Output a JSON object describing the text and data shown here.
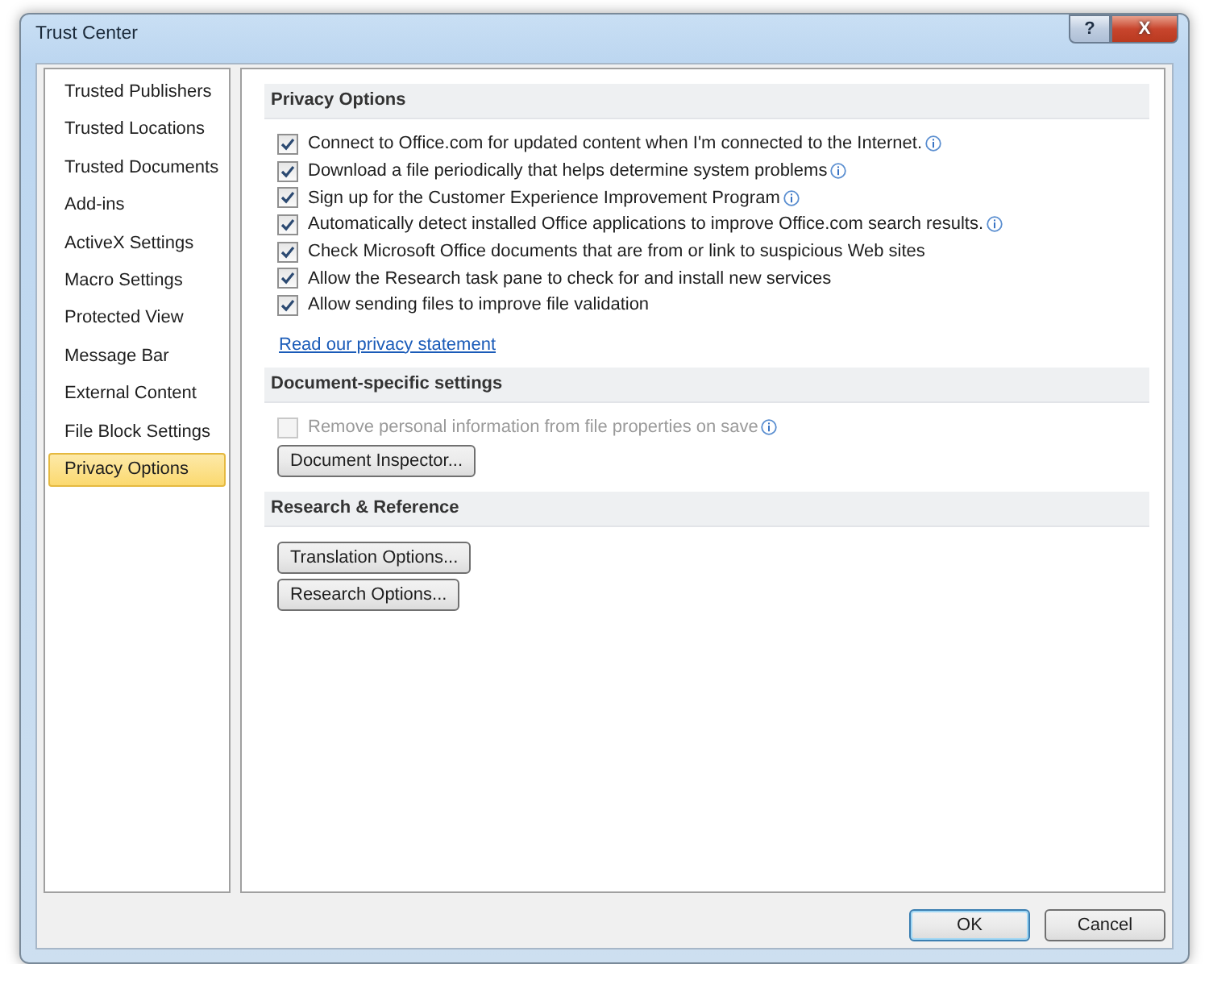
{
  "window": {
    "title": "Trust Center",
    "buttons": [
      {
        "kind": "help",
        "label": "?"
      },
      {
        "kind": "close",
        "label": "X"
      }
    ]
  },
  "sidebar": {
    "items": [
      {
        "label": "Trusted Publishers",
        "selected": false
      },
      {
        "label": "Trusted Locations",
        "selected": false
      },
      {
        "label": "Trusted Documents",
        "selected": false
      },
      {
        "label": "Add-ins",
        "selected": false
      },
      {
        "label": "ActiveX Settings",
        "selected": false
      },
      {
        "label": "Macro Settings",
        "selected": false
      },
      {
        "label": "Protected View",
        "selected": false
      },
      {
        "label": "Message Bar",
        "selected": false
      },
      {
        "label": "External Content",
        "selected": false
      },
      {
        "label": "File Block Settings",
        "selected": false
      },
      {
        "label": "Privacy Options",
        "selected": true
      }
    ]
  },
  "sections": [
    {
      "title": "Privacy Options",
      "items": [
        {
          "kind": "checkbox",
          "label": "Connect to Office.com for updated content when I'm connected to the Internet.",
          "checked": true,
          "disabled": false,
          "info": true
        },
        {
          "kind": "checkbox",
          "label": "Download a file periodically that helps determine system problems",
          "checked": true,
          "disabled": false,
          "info": true
        },
        {
          "kind": "checkbox",
          "label": "Sign up for the Customer Experience Improvement Program",
          "checked": true,
          "disabled": false,
          "info": true
        },
        {
          "kind": "checkbox",
          "label": "Automatically detect installed Office applications to improve Office.com search results.",
          "checked": true,
          "disabled": false,
          "info": true
        },
        {
          "kind": "checkbox",
          "label": "Check Microsoft Office documents that are from or link to suspicious Web sites",
          "checked": true,
          "disabled": false,
          "info": false
        },
        {
          "kind": "checkbox",
          "label": "Allow the Research task pane to check for and install new services",
          "checked": true,
          "disabled": false,
          "info": false
        },
        {
          "kind": "checkbox",
          "label": "Allow sending files to improve file validation",
          "checked": true,
          "disabled": false,
          "info": false
        },
        {
          "kind": "link",
          "label": "Read our privacy statement"
        }
      ]
    },
    {
      "title": "Document-specific settings",
      "items": [
        {
          "kind": "checkbox",
          "label": "Remove personal information from file properties on save",
          "checked": false,
          "disabled": true,
          "info": true
        },
        {
          "kind": "button",
          "label": "Document Inspector..."
        }
      ]
    },
    {
      "title": "Research & Reference",
      "items": [
        {
          "kind": "button",
          "label": "Translation Options..."
        },
        {
          "kind": "button",
          "label": "Research Options..."
        }
      ]
    }
  ],
  "footer": {
    "buttons": [
      {
        "label": "OK",
        "default": true
      },
      {
        "label": "Cancel",
        "default": false
      }
    ]
  }
}
